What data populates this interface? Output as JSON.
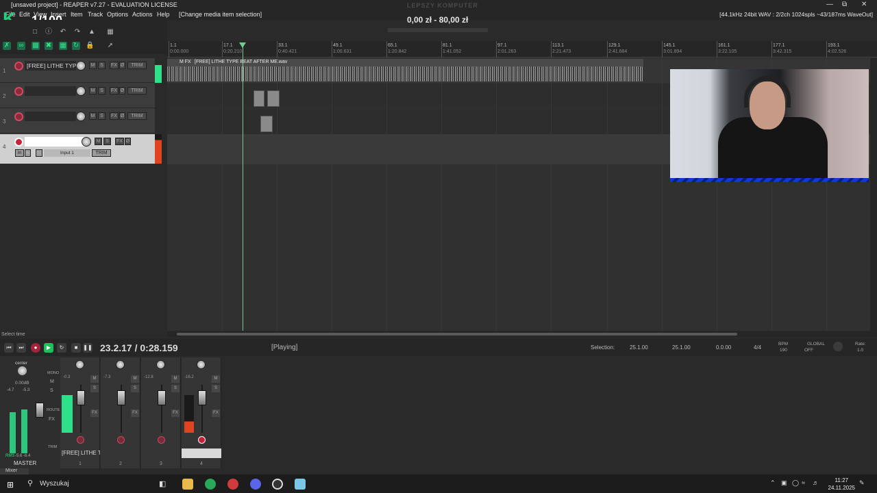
{
  "window": {
    "title": "[unsaved project] - REAPER v7.27 - EVALUATION LICENSE",
    "overlay_text": "LEPSZY KOMPUTER",
    "price_text": "0,00 zł - 80,00 zł",
    "logo_letter": "K",
    "logo_counter": "1/100"
  },
  "menu": {
    "items": [
      "File",
      "Edit",
      "View",
      "Insert",
      "Item",
      "Track",
      "Options",
      "Actions",
      "Help",
      "[Change media item selection]"
    ],
    "audio_status": "[44.1kHz 24bit WAV : 2/2ch 1024spls ~43/187ms WaveOut]"
  },
  "ruler": {
    "marks": [
      {
        "bar": "1.1",
        "time": "0:00.000"
      },
      {
        "bar": "17.1",
        "time": "0:20.210"
      },
      {
        "bar": "33.1",
        "time": "0:40.421"
      },
      {
        "bar": "49.1",
        "time": "1:00.631"
      },
      {
        "bar": "65.1",
        "time": "1:20.842"
      },
      {
        "bar": "81.1",
        "time": "1:41.052"
      },
      {
        "bar": "97.1",
        "time": "2:01.263"
      },
      {
        "bar": "113.1",
        "time": "2:21.473"
      },
      {
        "bar": "129.1",
        "time": "2:41.684"
      },
      {
        "bar": "145.1",
        "time": "3:01.894"
      },
      {
        "bar": "161.1",
        "time": "3:22.105"
      },
      {
        "bar": "177.1",
        "time": "3:42.315"
      },
      {
        "bar": "193.1",
        "time": "4:02.526"
      }
    ]
  },
  "tracks": [
    {
      "num": "1",
      "name": "[FREE] LITHE TYPE BE",
      "m": "M",
      "s": "S",
      "fx": "FX",
      "trim": "TRIM"
    },
    {
      "num": "2",
      "name": "",
      "m": "M",
      "s": "S",
      "fx": "FX",
      "trim": "TRIM"
    },
    {
      "num": "3",
      "name": "",
      "m": "M",
      "s": "S",
      "fx": "FX",
      "trim": "TRIM"
    },
    {
      "num": "4",
      "name": "",
      "m": "M",
      "s": "S",
      "fx": "FX",
      "trim": "TRIM",
      "input": "Input 1",
      "in_label": "in"
    }
  ],
  "media_item": {
    "name": "[FREE] LITHE TYPE BEAT AFTER ME.wav",
    "badges": "M FX"
  },
  "status_left": "Select time",
  "transport": {
    "position": "23.2.17 / 0:28.159",
    "state": "[Playing]",
    "selection_label": "Selection:",
    "sel_start": "25.1.00",
    "sel_end": "25.1.00",
    "sel_len": "0.0.00",
    "timesig": "4/4",
    "bpm_label": "BPM",
    "bpm": "190",
    "global_label": "GLOBAL",
    "global_state": "OFF",
    "rate_label": "Rate:",
    "rate": "1.0"
  },
  "mixer": {
    "master_label": "MASTER",
    "master_pan": "center",
    "master_vol": "0.00dB",
    "master_peaks": [
      "-4.7",
      "-5.3"
    ],
    "master_rms_label": "RMS",
    "master_rms_vals": [
      "-5.6",
      "-6.4"
    ],
    "master_buttons": [
      "MONO",
      "M",
      "S",
      "ROUTE",
      "FX",
      "TRIM"
    ],
    "tab": "Mixer",
    "strips": [
      {
        "num": "1",
        "vol": "-0.3",
        "label": "[FREE] LITHE T"
      },
      {
        "num": "2",
        "vol": "-7.3",
        "label": ""
      },
      {
        "num": "3",
        "vol": "-12.8",
        "label": ""
      },
      {
        "num": "4",
        "vol": "-16.2",
        "label": ""
      }
    ],
    "strip_buttons": {
      "m": "M",
      "s": "S",
      "fx": "FX"
    }
  },
  "taskbar": {
    "search_placeholder": "Wyszukaj",
    "time": "11:27",
    "date": "24.11.2025"
  },
  "colors": {
    "accent_green": "#2ee08a",
    "record_red": "#c6223c",
    "play_green": "#1fbf5a",
    "playhead": "#6fcf8f"
  }
}
